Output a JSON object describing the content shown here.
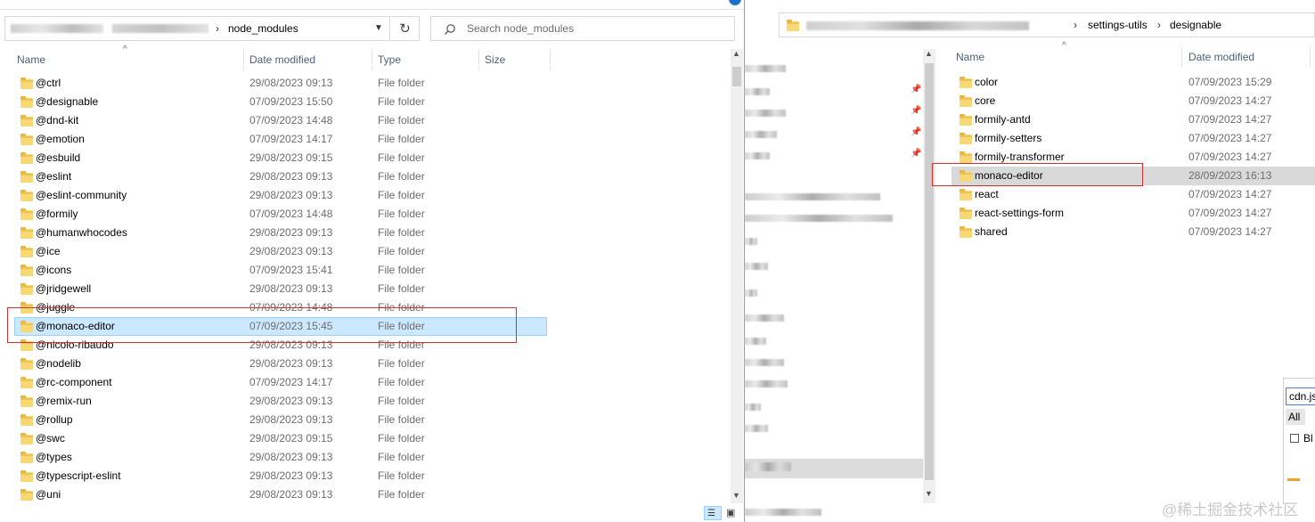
{
  "left": {
    "path_current": "node_modules",
    "search_placeholder": "Search node_modules",
    "columns": {
      "name": "Name",
      "date": "Date modified",
      "type": "Type",
      "size": "Size"
    },
    "rows": [
      {
        "name": "@ctrl",
        "date": "29/08/2023 09:13",
        "type": "File folder"
      },
      {
        "name": "@designable",
        "date": "07/09/2023 15:50",
        "type": "File folder"
      },
      {
        "name": "@dnd-kit",
        "date": "07/09/2023 14:48",
        "type": "File folder"
      },
      {
        "name": "@emotion",
        "date": "07/09/2023 14:17",
        "type": "File folder"
      },
      {
        "name": "@esbuild",
        "date": "29/08/2023 09:15",
        "type": "File folder"
      },
      {
        "name": "@eslint",
        "date": "29/08/2023 09:13",
        "type": "File folder"
      },
      {
        "name": "@eslint-community",
        "date": "29/08/2023 09:13",
        "type": "File folder"
      },
      {
        "name": "@formily",
        "date": "07/09/2023 14:48",
        "type": "File folder"
      },
      {
        "name": "@humanwhocodes",
        "date": "29/08/2023 09:13",
        "type": "File folder"
      },
      {
        "name": "@ice",
        "date": "29/08/2023 09:13",
        "type": "File folder"
      },
      {
        "name": "@icons",
        "date": "07/09/2023 15:41",
        "type": "File folder"
      },
      {
        "name": "@jridgewell",
        "date": "29/08/2023 09:13",
        "type": "File folder"
      },
      {
        "name": "@juggle",
        "date": "07/09/2023 14:48",
        "type": "File folder"
      },
      {
        "name": "@monaco-editor",
        "date": "07/09/2023 15:45",
        "type": "File folder"
      },
      {
        "name": "@nicolo-ribaudo",
        "date": "29/08/2023 09:13",
        "type": "File folder"
      },
      {
        "name": "@nodelib",
        "date": "29/08/2023 09:13",
        "type": "File folder"
      },
      {
        "name": "@rc-component",
        "date": "07/09/2023 14:17",
        "type": "File folder"
      },
      {
        "name": "@remix-run",
        "date": "29/08/2023 09:13",
        "type": "File folder"
      },
      {
        "name": "@rollup",
        "date": "29/08/2023 09:13",
        "type": "File folder"
      },
      {
        "name": "@swc",
        "date": "29/08/2023 09:15",
        "type": "File folder"
      },
      {
        "name": "@types",
        "date": "29/08/2023 09:13",
        "type": "File folder"
      },
      {
        "name": "@typescript-eslint",
        "date": "29/08/2023 09:13",
        "type": "File folder"
      },
      {
        "name": "@uni",
        "date": "29/08/2023 09:13",
        "type": "File folder"
      }
    ]
  },
  "right": {
    "breadcrumb": [
      "settings-utils",
      "designable"
    ],
    "columns": {
      "name": "Name",
      "date": "Date modified"
    },
    "rows": [
      {
        "name": "color",
        "date": "07/09/2023 15:29"
      },
      {
        "name": "core",
        "date": "07/09/2023 14:27"
      },
      {
        "name": "formily-antd",
        "date": "07/09/2023 14:27"
      },
      {
        "name": "formily-setters",
        "date": "07/09/2023 14:27"
      },
      {
        "name": "formily-transformer",
        "date": "07/09/2023 14:27"
      },
      {
        "name": "monaco-editor",
        "date": "28/09/2023 16:13"
      },
      {
        "name": "react",
        "date": "07/09/2023 14:27"
      },
      {
        "name": "react-settings-form",
        "date": "07/09/2023 14:27"
      },
      {
        "name": "shared",
        "date": "07/09/2023 14:27"
      }
    ],
    "popup": {
      "input_value": "cdn.js",
      "tab_all": "All",
      "checkbox_label": "Bl"
    }
  },
  "watermark": "@稀土掘金技术社区",
  "colors": {
    "selection": "#cce8ff",
    "selection_border": "#99d1ff",
    "highlight_box": "#d32f2f",
    "header_text": "#4c607a"
  }
}
